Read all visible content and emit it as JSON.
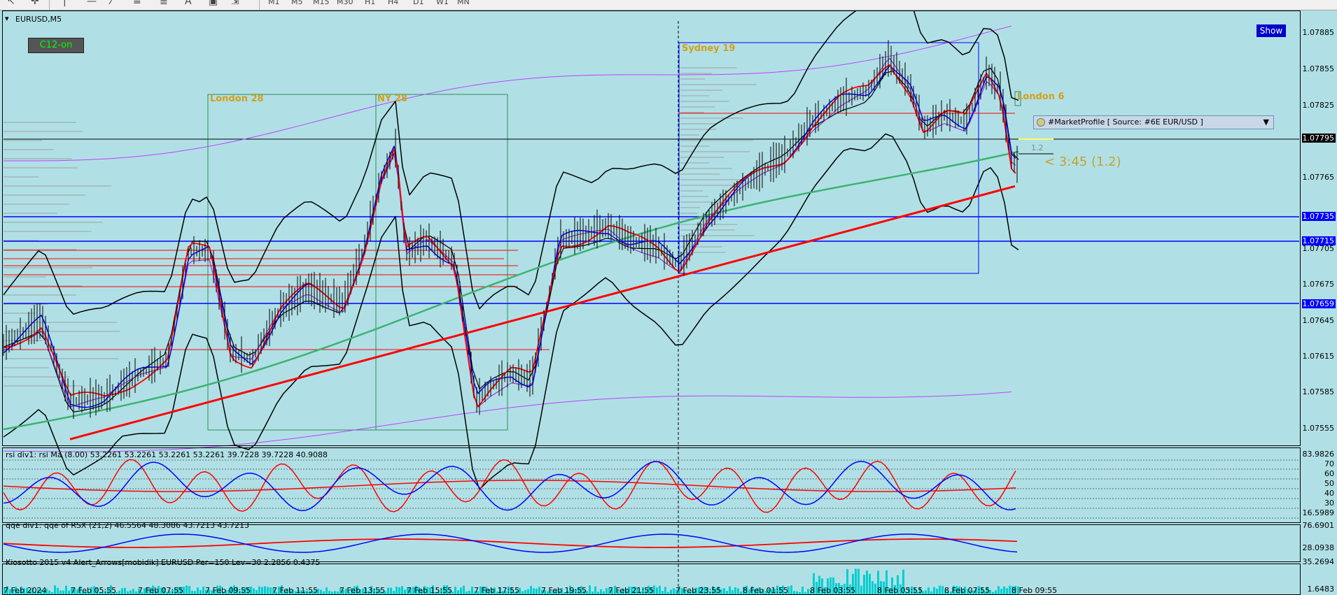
{
  "toolbar": {
    "timeframes": [
      "M1",
      "M5",
      "M15",
      "M30",
      "H1",
      "H4",
      "D1",
      "W1",
      "MN"
    ]
  },
  "chart": {
    "symbol_title": "EURUSD,M5",
    "c12_label": "C12-on",
    "show_label": "Show",
    "market_profile_label": "#MarketProfile [ Source: #6E EUR/USD ]",
    "timer_label": "< 3:45 (1.2)",
    "small_label": "1.2",
    "sessions": {
      "london28": "London 28",
      "ny28": "NY 28",
      "sydney19": "Sydney 19",
      "london6": "London 6"
    },
    "price_axis": [
      "1.07885",
      "1.07855",
      "1.07825",
      "1.07765",
      "1.07705",
      "1.07675",
      "1.07645",
      "1.07615",
      "1.07585",
      "1.07555"
    ],
    "highlighted_levels": [
      "1.07735",
      "1.07715",
      "1.07659"
    ],
    "current_price": "1.07795",
    "time_axis": [
      "7 Feb 2024",
      "7 Feb 05:55",
      "7 Feb 07:55",
      "7 Feb 09:55",
      "7 Feb 11:55",
      "7 Feb 13:55",
      "7 Feb 15:55",
      "7 Feb 17:55",
      "7 Feb 19:55",
      "7 Feb 21:55",
      "7 Feb 23:55",
      "8 Feb 01:55",
      "8 Feb 03:55",
      "8 Feb 05:55",
      "8 Feb 07:55",
      "8 Feb 09:55"
    ]
  },
  "rsi_pane": {
    "label": "rsi div1: rsi Ma (8.00) 53.2261 53.2261 53.2261 53.2261 39.7228 39.7228 40.9088",
    "axis": [
      "83.9826",
      "70",
      "60",
      "50",
      "40",
      "30",
      "16.5989"
    ]
  },
  "qqe_pane": {
    "label": "qqe div1: qqe of RSX (21,2) 46.5564 48.3086 43.7213 43.7213",
    "axis": [
      "76.6901",
      "28.0938"
    ]
  },
  "kiosotto_pane": {
    "label": "Kiosotto 2015 v4 Alert_Arrows[mobidik] EURUSD Per=150 Lev=30 2.2856 0.4375",
    "axis": [
      "35.2694",
      "1.6483"
    ]
  },
  "colors": {
    "background": "#b0e0e6",
    "level_blue": "#0000ff",
    "ma_red": "#ff0000",
    "ma_green": "#3cb371",
    "band_violet": "#c040ff",
    "session_gold": "#d4a017"
  }
}
